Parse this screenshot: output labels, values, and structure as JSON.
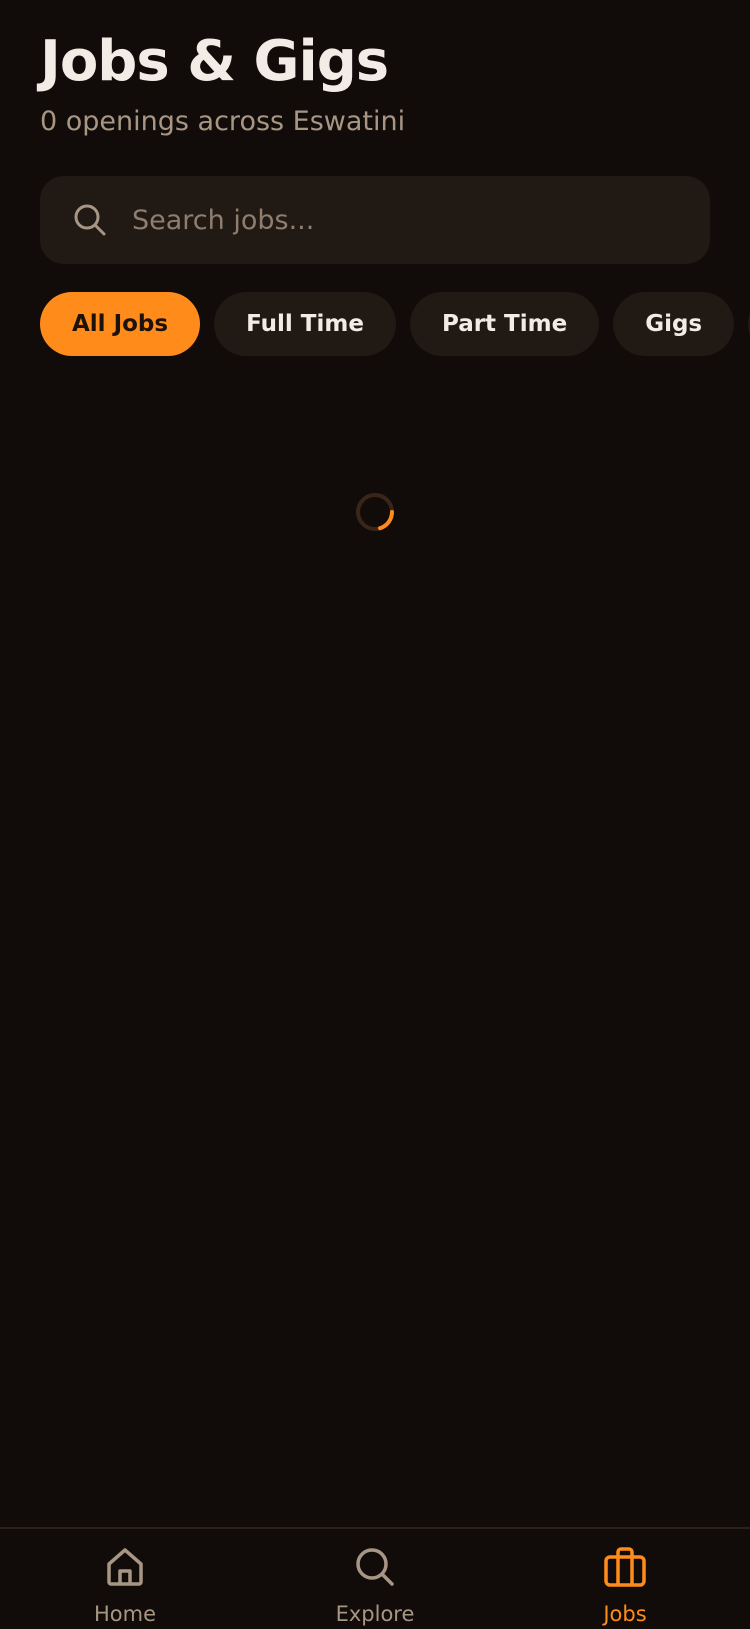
{
  "header": {
    "title": "Jobs & Gigs",
    "subtitle": "0 openings across Eswatini"
  },
  "search": {
    "placeholder": "Search jobs...",
    "value": "",
    "icon": "search-icon"
  },
  "filters": {
    "chips": [
      {
        "label": "All Jobs",
        "active": true
      },
      {
        "label": "Full Time",
        "active": false
      },
      {
        "label": "Part Time",
        "active": false
      },
      {
        "label": "Gigs",
        "active": false
      }
    ]
  },
  "loading": {
    "icon": "loading-spinner-icon"
  },
  "bottom_nav": {
    "items": [
      {
        "label": "Home",
        "icon": "home-icon",
        "active": false
      },
      {
        "label": "Explore",
        "icon": "search-icon",
        "active": false
      },
      {
        "label": "Jobs",
        "icon": "briefcase-icon",
        "active": true
      }
    ]
  },
  "colors": {
    "background": "#110c09",
    "surface": "#211913",
    "accent": "#ff8c1a",
    "text_primary": "#f3ece6",
    "text_secondary": "#a89684"
  }
}
